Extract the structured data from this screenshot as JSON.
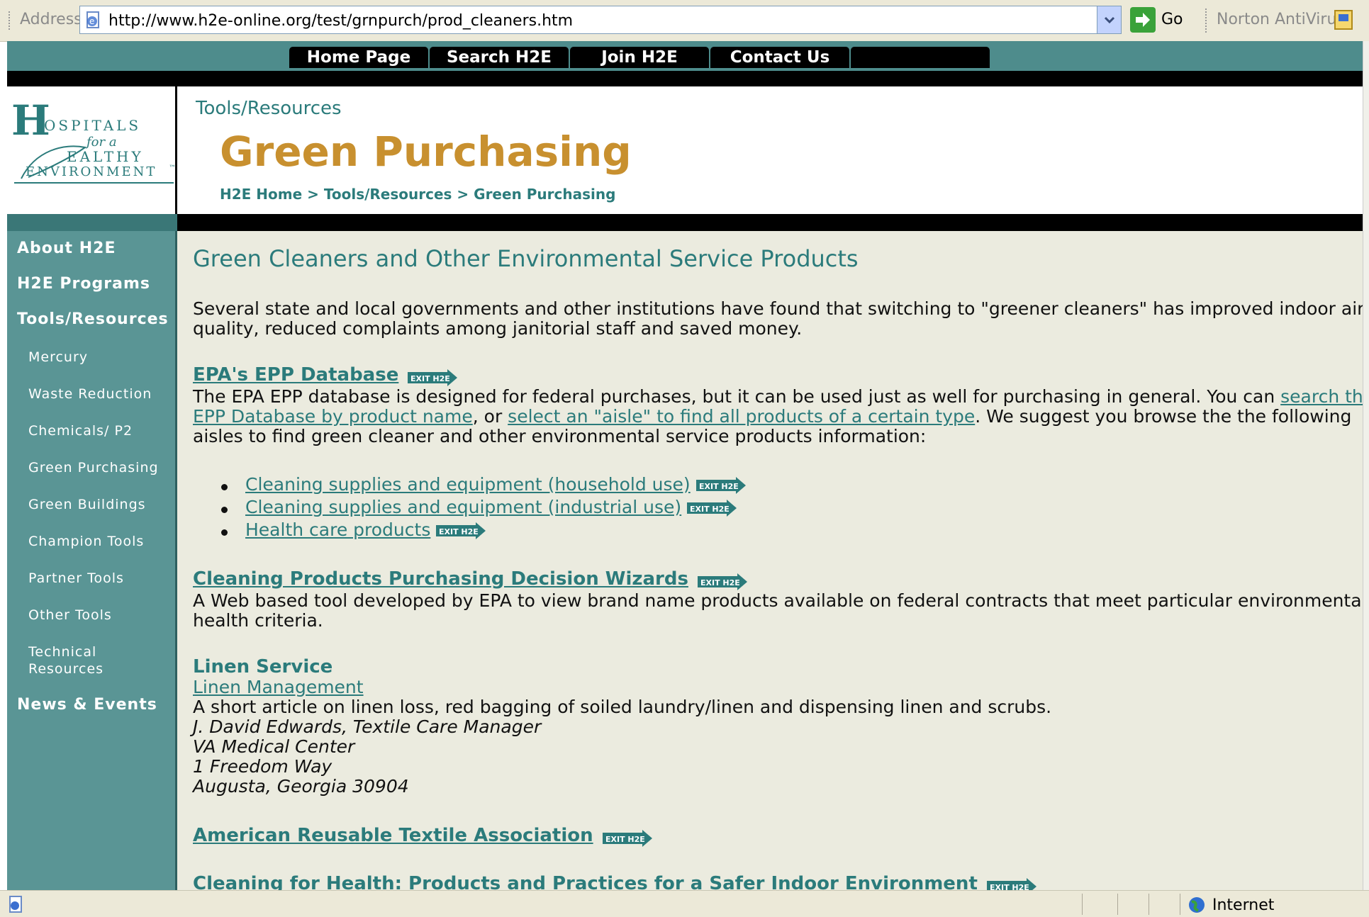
{
  "browser": {
    "address_label": "Address",
    "url": "http://www.h2e-online.org/test/grnpurch/prod_cleaners.htm",
    "go_label": "Go",
    "toolbar_extension": "Norton AntiVirus",
    "status_zone": "Internet"
  },
  "topnav": {
    "items": [
      "Home Page",
      "Search H2E",
      "Join H2E",
      "Contact Us",
      ""
    ]
  },
  "logo": {
    "line1": "OSPITALS",
    "letter": "H",
    "line2": "for a",
    "line3": "EALTHY",
    "line4": "ENVIRONMENT",
    "tm": "™"
  },
  "header": {
    "section": "Tools/Resources",
    "title": "Green Purchasing",
    "breadcrumb": [
      "H2E Home",
      "Tools/Resources",
      "Green Purchasing"
    ],
    "breadcrumb_sep": ">"
  },
  "sidebar": {
    "main_items": [
      "About H2E",
      "H2E Programs",
      "Tools/Resources"
    ],
    "sub_items": [
      "Mercury",
      "Waste Reduction",
      "Chemicals/ P2",
      "Green Purchasing",
      "Green Buildings",
      "Champion Tools",
      "Partner Tools",
      "Other Tools",
      "Technical",
      "Resources"
    ],
    "last_item": "News & Events"
  },
  "main": {
    "heading": "Green Cleaners and Other Environmental Service Products",
    "intro_line1": "Several state and local governments and other institutions have found that switching to \"greener cleaners\" has improved indoor air",
    "intro_line2": "quality, reduced complaints among janitorial staff and saved money.",
    "exit_badge": "EXIT H2E",
    "epp": {
      "title": "EPA's EPP Database",
      "text1": "The EPA EPP database is designed for federal purchases, but it can be used just as well for purchasing in general. You can ",
      "link1a": "search the",
      "link1b": "EPP Database by product name",
      "text2": ", or ",
      "link2": "select an \"aisle\" to find all products of a certain type",
      "text3": ". We suggest you browse the the following",
      "text4": "aisles to find green cleaner and other environmental service products information:",
      "bullets": [
        "Cleaning supplies and equipment (household use)",
        "Cleaning supplies and equipment (industrial use)",
        "Health care products"
      ]
    },
    "wizards": {
      "title": "Cleaning Products Purchasing Decision Wizards",
      "line1": "A Web based tool developed by EPA to view brand name products available on federal contracts that meet particular environmental or",
      "line2": "health criteria."
    },
    "linen": {
      "title": "Linen Service",
      "link": "Linen Management",
      "desc": "A short article on linen loss, red bagging of soiled laundry/linen and dispensing linen and scrubs.",
      "author": "J. David Edwards, Textile Care Manager",
      "org": "VA Medical Center",
      "addr1": "1 Freedom Way",
      "addr2": "Augusta, Georgia 30904"
    },
    "arta": "American Reusable Textile Association",
    "cfh": "Cleaning for Health: Products and Practices for a Safer Indoor Environment"
  },
  "colors": {
    "teal": "#2b7b7b",
    "sidebar": "#5a9595",
    "gold": "#c8902f",
    "main_bg": "#ebebdf"
  }
}
